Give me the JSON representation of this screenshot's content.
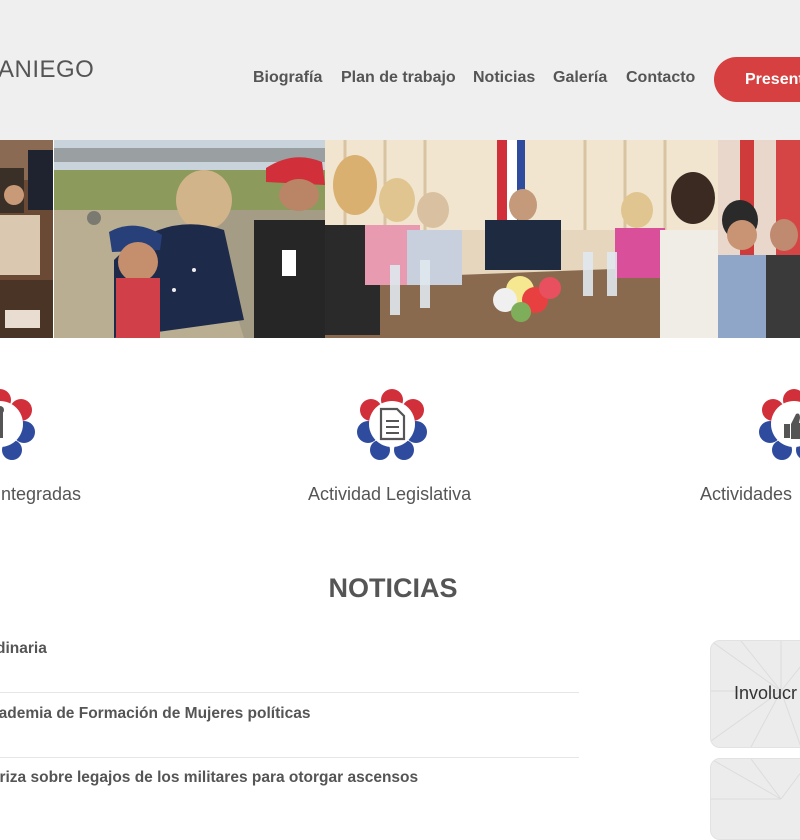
{
  "header": {
    "logo_text": "ANIEGO",
    "nav": [
      "Biografía",
      "Plan de trabajo",
      "Noticias",
      "Galería",
      "Contacto"
    ],
    "cta_label": "Present",
    "cta_color": "#d64040"
  },
  "features": [
    {
      "label": "Integradas",
      "icon": "tools-icon"
    },
    {
      "label": "Actividad Legislativa",
      "icon": "document-icon"
    },
    {
      "label": "Actividades",
      "icon": "thumbs-up-icon"
    }
  ],
  "news": {
    "heading": "NOTICIAS",
    "items": [
      "rdinaria",
      "cademia de Formación de Mujeres políticas",
      "oriza sobre legajos de los militares para otorgar ascensos"
    ],
    "side_cards": [
      "Involucr",
      ""
    ]
  },
  "colors": {
    "brand_red": "#d64040",
    "brand_blue": "#2e4b9e",
    "header_bg": "#efefef"
  }
}
